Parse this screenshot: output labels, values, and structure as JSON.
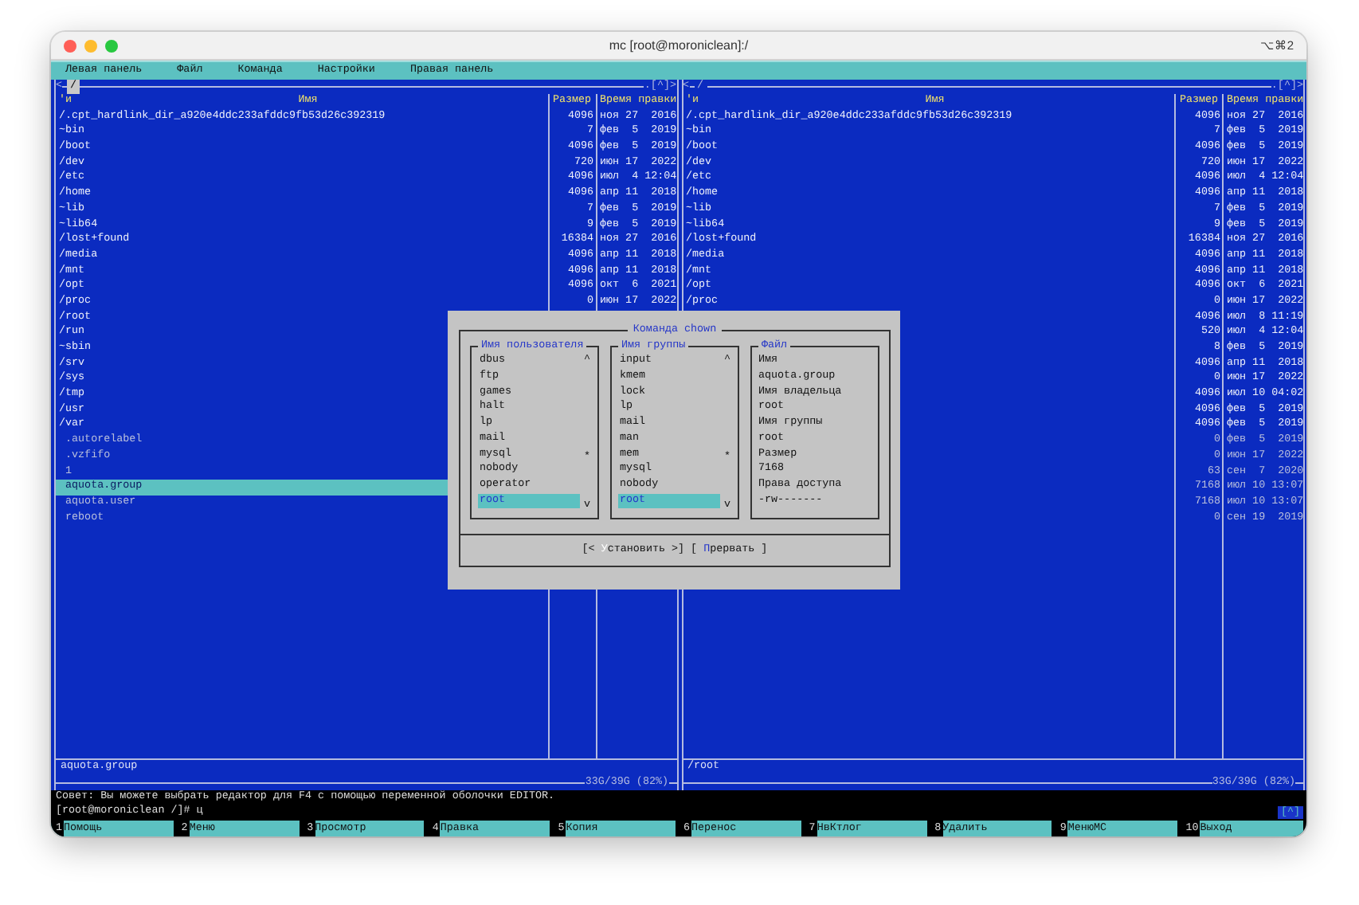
{
  "window": {
    "title": "mc [root@moroniclean]:/",
    "shortcut": "⌥⌘2"
  },
  "menu": [
    {
      "label": "Левая панель"
    },
    {
      "label": "Файл"
    },
    {
      "label": "Команда"
    },
    {
      "label": "Настройки"
    },
    {
      "label": "Правая панель"
    }
  ],
  "panels": [
    {
      "nav_mark": "<",
      "path": "/",
      "active": true,
      "scroll_mark": ".[^]>",
      "sort_mark": "'и",
      "columns": [
        "Имя",
        "Размер",
        "Время правки"
      ],
      "rows": [
        {
          "name": "/.cpt_hardlink_dir_a920e4ddc233afddc9fb53d26c392319",
          "size": "4096",
          "date": "ноя 27  2016",
          "kind": "dir",
          "selected": false
        },
        {
          "name": "~bin",
          "size": "7",
          "date": "фев  5  2019",
          "kind": "dir",
          "selected": false
        },
        {
          "name": "/boot",
          "size": "4096",
          "date": "фев  5  2019",
          "kind": "dir",
          "selected": false
        },
        {
          "name": "/dev",
          "size": "720",
          "date": "июн 17  2022",
          "kind": "dir",
          "selected": false
        },
        {
          "name": "/etc",
          "size": "4096",
          "date": "июл  4 12:04",
          "kind": "dir",
          "selected": false
        },
        {
          "name": "/home",
          "size": "4096",
          "date": "апр 11  2018",
          "kind": "dir",
          "selected": false
        },
        {
          "name": "~lib",
          "size": "7",
          "date": "фев  5  2019",
          "kind": "dir",
          "selected": false
        },
        {
          "name": "~lib64",
          "size": "9",
          "date": "фев  5  2019",
          "kind": "dir",
          "selected": false
        },
        {
          "name": "/lost+found",
          "size": "16384",
          "date": "ноя 27  2016",
          "kind": "dir",
          "selected": false
        },
        {
          "name": "/media",
          "size": "4096",
          "date": "апр 11  2018",
          "kind": "dir",
          "selected": false
        },
        {
          "name": "/mnt",
          "size": "4096",
          "date": "апр 11  2018",
          "kind": "dir",
          "selected": false
        },
        {
          "name": "/opt",
          "size": "4096",
          "date": "окт  6  2021",
          "kind": "dir",
          "selected": false
        },
        {
          "name": "/proc",
          "size": "0",
          "date": "июн 17  2022",
          "kind": "dir",
          "selected": false
        },
        {
          "name": "/root",
          "kind": "dir",
          "selected": false
        },
        {
          "name": "/run",
          "kind": "dir",
          "selected": false
        },
        {
          "name": "~sbin",
          "kind": "dir",
          "selected": false
        },
        {
          "name": "/srv",
          "kind": "dir",
          "selected": false
        },
        {
          "name": "/sys",
          "kind": "dir",
          "selected": false
        },
        {
          "name": "/tmp",
          "kind": "dir",
          "selected": false
        },
        {
          "name": "/usr",
          "kind": "dir",
          "selected": false
        },
        {
          "name": "/var",
          "kind": "dir",
          "selected": false
        },
        {
          "name": " .autorelabel",
          "kind": "file",
          "selected": false
        },
        {
          "name": " .vzfifo",
          "kind": "file",
          "selected": false
        },
        {
          "name": " 1",
          "kind": "file",
          "selected": false
        },
        {
          "name": " aquota.group",
          "kind": "file",
          "selected": true
        },
        {
          "name": " aquota.user",
          "kind": "file",
          "selected": false
        },
        {
          "name": " reboot",
          "kind": "file",
          "selected": false
        }
      ],
      "status": "aquota.group",
      "disk": "33G/39G (82%)"
    },
    {
      "nav_mark": "<",
      "path": "/",
      "active": false,
      "scroll_mark": ".[^]>",
      "sort_mark": "'и",
      "columns": [
        "Имя",
        "Размер",
        "Время правки"
      ],
      "rows": [
        {
          "name": "/.cpt_hardlink_dir_a920e4ddc233afddc9fb53d26c392319",
          "size": "4096",
          "date": "ноя 27  2016",
          "kind": "dir",
          "selected": false
        },
        {
          "name": "~bin",
          "size": "7",
          "date": "фев  5  2019",
          "kind": "dir",
          "selected": false
        },
        {
          "name": "/boot",
          "size": "4096",
          "date": "фев  5  2019",
          "kind": "dir",
          "selected": false
        },
        {
          "name": "/dev",
          "size": "720",
          "date": "июн 17  2022",
          "kind": "dir",
          "selected": false
        },
        {
          "name": "/etc",
          "size": "4096",
          "date": "июл  4 12:04",
          "kind": "dir",
          "selected": false
        },
        {
          "name": "/home",
          "size": "4096",
          "date": "апр 11  2018",
          "kind": "dir",
          "selected": false
        },
        {
          "name": "~lib",
          "size": "7",
          "date": "фев  5  2019",
          "kind": "dir",
          "selected": false
        },
        {
          "name": "~lib64",
          "size": "9",
          "date": "фев  5  2019",
          "kind": "dir",
          "selected": false
        },
        {
          "name": "/lost+found",
          "size": "16384",
          "date": "ноя 27  2016",
          "kind": "dir",
          "selected": false
        },
        {
          "name": "/media",
          "size": "4096",
          "date": "апр 11  2018",
          "kind": "dir",
          "selected": false
        },
        {
          "name": "/mnt",
          "size": "4096",
          "date": "апр 11  2018",
          "kind": "dir",
          "selected": false
        },
        {
          "name": "/opt",
          "size": "4096",
          "date": "окт  6  2021",
          "kind": "dir",
          "selected": false
        },
        {
          "name": "/proc",
          "size": "0",
          "date": "июн 17  2022",
          "kind": "dir",
          "selected": false
        },
        {
          "size": "4096",
          "date": "июл  8 11:19",
          "kind": "dir",
          "selected": false
        },
        {
          "size": "520",
          "date": "июл  4 12:04",
          "kind": "dir",
          "selected": false
        },
        {
          "size": "8",
          "date": "фев  5  2019",
          "kind": "dir",
          "selected": false
        },
        {
          "size": "4096",
          "date": "апр 11  2018",
          "kind": "dir",
          "selected": false
        },
        {
          "size": "0",
          "date": "июн 17  2022",
          "kind": "dir",
          "selected": false
        },
        {
          "size": "4096",
          "date": "июл 10 04:02",
          "kind": "dir",
          "selected": false
        },
        {
          "size": "4096",
          "date": "фев  5  2019",
          "kind": "dir",
          "selected": false
        },
        {
          "size": "4096",
          "date": "фев  5  2019",
          "kind": "dir",
          "selected": false
        },
        {
          "size": "0",
          "date": "фев  5  2019",
          "kind": "file",
          "selected": false
        },
        {
          "size": "0",
          "date": "июн 17  2022",
          "kind": "file",
          "selected": false
        },
        {
          "size": "63",
          "date": "сен  7  2020",
          "kind": "file",
          "selected": false
        },
        {
          "size": "7168",
          "date": "июл 10 13:07",
          "kind": "file",
          "selected": false
        },
        {
          "size": "7168",
          "date": "июл 10 13:07",
          "kind": "file",
          "selected": false
        },
        {
          "size": "0",
          "date": "сен 19  2019",
          "kind": "file",
          "selected": false
        }
      ],
      "status": "/root",
      "disk": "33G/39G (82%)"
    }
  ],
  "dialog": {
    "title": "Команда chown",
    "groups": [
      {
        "title": "Имя пользователя",
        "kind": "list",
        "scroll": {
          "up": "^",
          "thumb": "*",
          "down": "v"
        },
        "items": [
          {
            "label": "dbus",
            "selected": false
          },
          {
            "label": "ftp",
            "selected": false
          },
          {
            "label": "games",
            "selected": false
          },
          {
            "label": "halt",
            "selected": false
          },
          {
            "label": "lp",
            "selected": false
          },
          {
            "label": "mail",
            "selected": false
          },
          {
            "label": "mysql",
            "selected": false
          },
          {
            "label": "nobody",
            "selected": false
          },
          {
            "label": "operator",
            "selected": false
          },
          {
            "label": "root",
            "selected": true
          }
        ]
      },
      {
        "title": "Имя группы",
        "kind": "list",
        "scroll": {
          "up": "^",
          "thumb": "*",
          "down": "v"
        },
        "items": [
          {
            "label": "input",
            "selected": false
          },
          {
            "label": "kmem",
            "selected": false
          },
          {
            "label": "lock",
            "selected": false
          },
          {
            "label": "lp",
            "selected": false
          },
          {
            "label": "mail",
            "selected": false
          },
          {
            "label": "man",
            "selected": false
          },
          {
            "label": "mem",
            "selected": false
          },
          {
            "label": "mysql",
            "selected": false
          },
          {
            "label": "nobody",
            "selected": false
          },
          {
            "label": "root",
            "selected": true
          }
        ]
      },
      {
        "title": "Файл",
        "kind": "info",
        "lines": [
          "Имя",
          "aquota.group",
          "Имя владельца",
          "root",
          "Имя группы",
          "root",
          "Размер",
          "7168",
          "Права доступа",
          "-rw-------"
        ]
      }
    ],
    "buttons": [
      {
        "before": "[< ",
        "hotkey": "У",
        "after": "становить >]",
        "default": true
      },
      {
        "before": "[ ",
        "hotkey": "П",
        "after": "рервать ]",
        "default": false
      }
    ]
  },
  "hint": "Совет: Вы можете выбрать редактор для F4 с помощью переменной оболочки EDITOR.",
  "command": {
    "prompt": "[root@moroniclean /]#",
    "value": "ц"
  },
  "scroll_button": "[^]",
  "keys": [
    {
      "number": "1",
      "label": "Помощь"
    },
    {
      "number": "2",
      "label": "Меню"
    },
    {
      "number": "3",
      "label": "Просмотр"
    },
    {
      "number": "4",
      "label": "Правка"
    },
    {
      "number": "5",
      "label": "Копия"
    },
    {
      "number": "6",
      "label": "Перенос"
    },
    {
      "number": "7",
      "label": "НвКтлог"
    },
    {
      "number": "8",
      "label": "Удалить"
    },
    {
      "number": "9",
      "label": "МенюМС"
    },
    {
      "number": "10",
      "label": "Выход"
    }
  ]
}
